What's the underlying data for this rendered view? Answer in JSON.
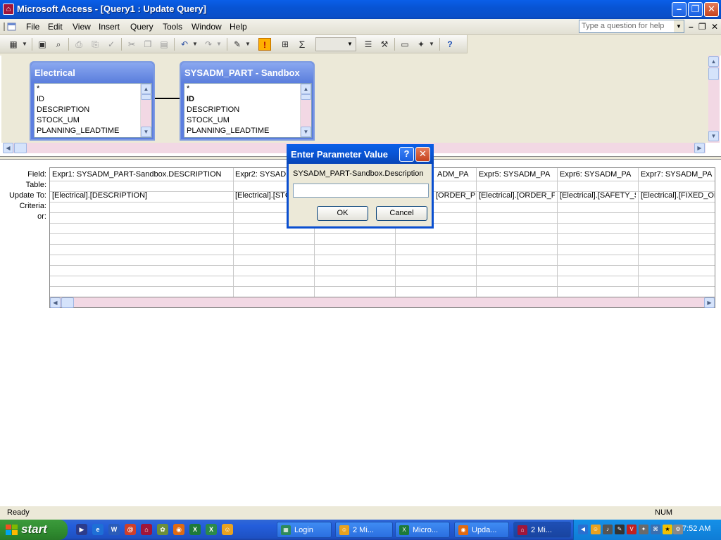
{
  "window": {
    "title": "Microsoft Access - [Query1 : Update Query]"
  },
  "menu": {
    "items": [
      "File",
      "Edit",
      "View",
      "Insert",
      "Query",
      "Tools",
      "Window",
      "Help"
    ],
    "help_placeholder": "Type a question for help"
  },
  "toolbar": {
    "sigma": "Σ"
  },
  "tables": [
    {
      "title": "Electrical",
      "fields": [
        "*",
        "ID",
        "DESCRIPTION",
        "STOCK_UM",
        "PLANNING_LEADTIME"
      ]
    },
    {
      "title": "SYSADM_PART - Sandbox",
      "fields": [
        "*",
        "ID",
        "DESCRIPTION",
        "STOCK_UM",
        "PLANNING_LEADTIME"
      ]
    }
  ],
  "grid": {
    "row_labels": [
      "Field:",
      "Table:",
      "Update To:",
      "Criteria:",
      "or:"
    ],
    "columns": [
      {
        "field": "Expr1: SYSADM_PART-Sandbox.DESCRIPTION",
        "update_to": "[Electrical].[DESCRIPTION]"
      },
      {
        "field": "Expr2: SYSADM",
        "update_to": "[Electrical].[STC"
      },
      {
        "field": "",
        "update_to": ""
      },
      {
        "field": "ADM_PA",
        "update_to": "[ORDER_PC"
      },
      {
        "field": "Expr5: SYSADM_PA",
        "update_to": "[Electrical].[ORDER_PC"
      },
      {
        "field": "Expr6: SYSADM_PA",
        "update_to": "[Electrical].[SAFETY_ST"
      },
      {
        "field": "Expr7: SYSADM_PA",
        "update_to": "[Electrical].[FIXED_OR"
      }
    ]
  },
  "dialog": {
    "title": "Enter Parameter Value",
    "help": "?",
    "prompt": "SYSADM_PART-Sandbox.Description",
    "value": "",
    "ok_label": "OK",
    "cancel_label": "Cancel"
  },
  "status": {
    "text": "Ready",
    "num": "NUM"
  },
  "taskbar": {
    "start_label": "start",
    "tasks": [
      "Login",
      "2 Mi...",
      "Micro...",
      "Upda...",
      "2 Mi..."
    ],
    "clock": "7:52 AM"
  }
}
